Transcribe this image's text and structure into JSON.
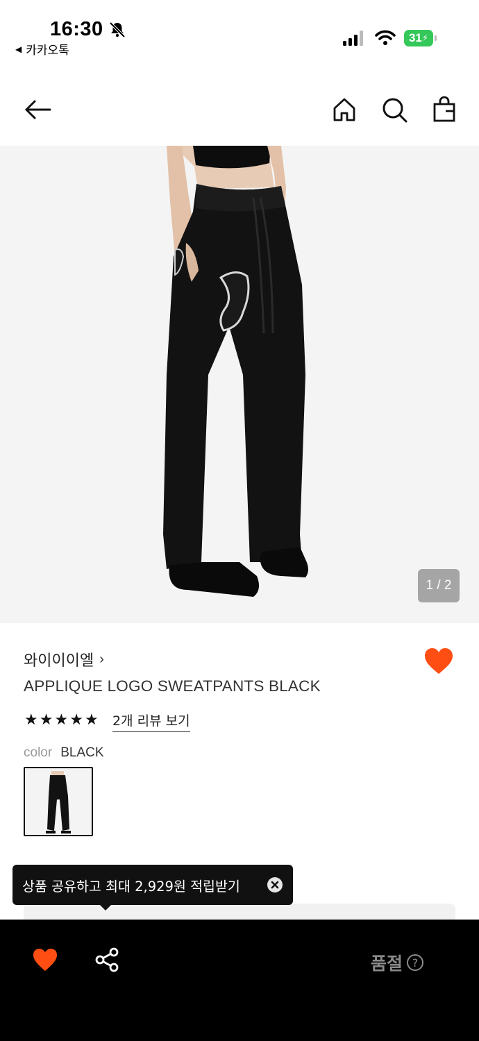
{
  "status_bar": {
    "time": "16:30",
    "back_app": "카카오톡",
    "battery": "31"
  },
  "nav": {
    "icons": [
      "back-arrow-icon",
      "home-icon",
      "search-icon",
      "shopping-bag-icon"
    ]
  },
  "gallery": {
    "counter": "1 / 2"
  },
  "product": {
    "brand": "와이이이엘",
    "brand_chevron": "›",
    "title": "APPLIQUE LOGO SWEATPANTS BLACK",
    "rating_stars": 5,
    "review_link": "2개 리뷰 보기",
    "color_label": "color",
    "color_value": "BLACK"
  },
  "toast": {
    "message": "상품 공유하고 최대 2,929원 적립받기"
  },
  "bottom_bar": {
    "status": "품절",
    "help": "?"
  },
  "colors": {
    "accent_heart": "#ff4e13",
    "bottom_bar_bg": "#000000",
    "battery": "#34c759"
  }
}
